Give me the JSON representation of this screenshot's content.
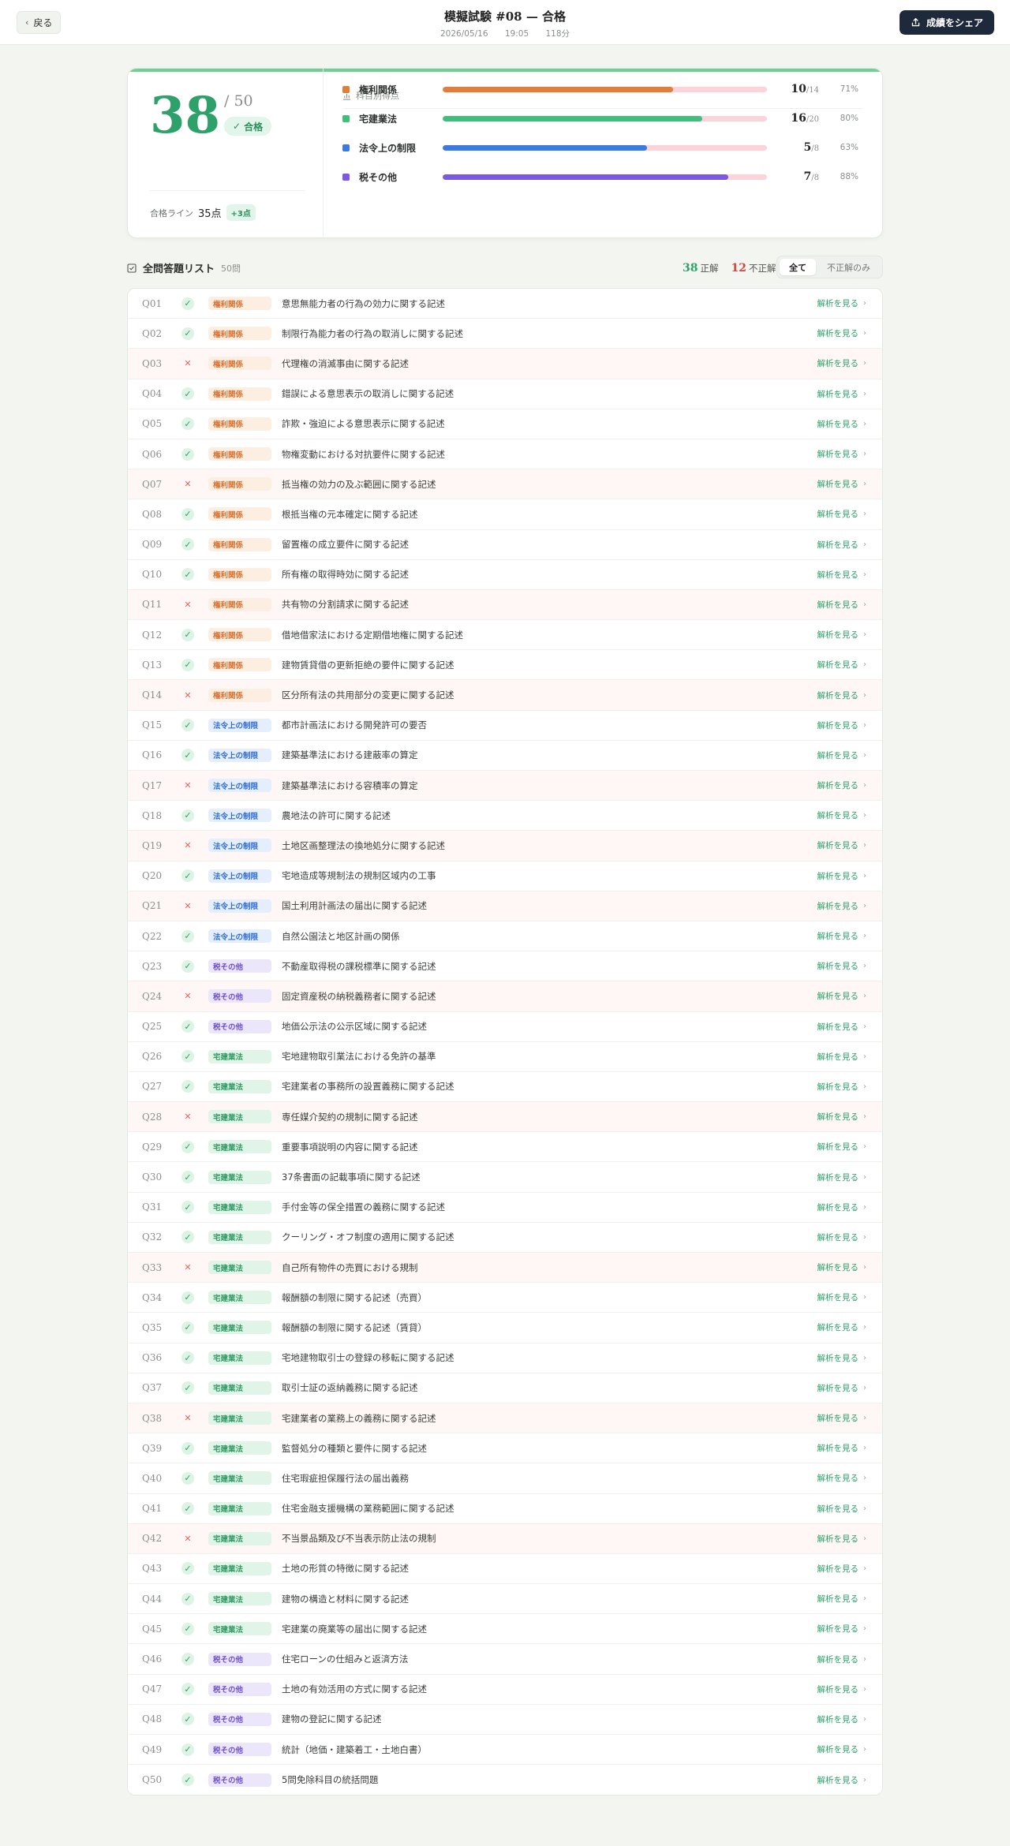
{
  "header": {
    "back_label": "戻る",
    "title": "模擬試験 #08 — 合格",
    "date": "2026/05/16",
    "time": "19:05",
    "duration": "118分",
    "share_label": "成績をシェア"
  },
  "score": {
    "value": "38",
    "total": "/ 50",
    "badge": "合格",
    "passline_label": "合格ライン",
    "passline_value": "35点",
    "passline_diff": "+3点"
  },
  "subjects": {
    "title": "科目別得点",
    "items": [
      {
        "name": "権利関係",
        "score": "10",
        "max": "/14",
        "pct": "71%",
        "ratio": 0.71,
        "color": "#e07f3a"
      },
      {
        "name": "宅建業法",
        "score": "16",
        "max": "/20",
        "pct": "80%",
        "ratio": 0.8,
        "color": "#3fbf7a"
      },
      {
        "name": "法令上の制限",
        "score": "5",
        "max": "/8",
        "pct": "63%",
        "ratio": 0.63,
        "color": "#3b7be0"
      },
      {
        "name": "税その他",
        "score": "7",
        "max": "/8",
        "pct": "88%",
        "ratio": 0.88,
        "color": "#7a5ae0"
      }
    ]
  },
  "list": {
    "title": "全問答題リスト",
    "count": "50問",
    "correct_count": "38",
    "correct_label": "正解",
    "wrong_count": "12",
    "wrong_label": "不正解",
    "filter_all": "全て",
    "filter_wrong": "不正解のみ",
    "link_label": "解析を見る"
  },
  "tag_styles": {
    "権利関係": {
      "bg": "#fdeee2",
      "fg": "#d87230"
    },
    "宅建業法": {
      "bg": "#e0f4e8",
      "fg": "#2e9a62"
    },
    "法令上の制限": {
      "bg": "#e4eefc",
      "fg": "#2f6ed0"
    },
    "税その他": {
      "bg": "#ece6fb",
      "fg": "#7050d0"
    }
  },
  "questions": [
    {
      "no": "Q01",
      "ok": true,
      "tag": "権利関係",
      "text": "意思無能力者の行為の効力に関する記述"
    },
    {
      "no": "Q02",
      "ok": true,
      "tag": "権利関係",
      "text": "制限行為能力者の行為の取消しに関する記述"
    },
    {
      "no": "Q03",
      "ok": false,
      "tag": "権利関係",
      "text": "代理権の消滅事由に関する記述"
    },
    {
      "no": "Q04",
      "ok": true,
      "tag": "権利関係",
      "text": "錯誤による意思表示の取消しに関する記述"
    },
    {
      "no": "Q05",
      "ok": true,
      "tag": "権利関係",
      "text": "詐欺・強迫による意思表示に関する記述"
    },
    {
      "no": "Q06",
      "ok": true,
      "tag": "権利関係",
      "text": "物権変動における対抗要件に関する記述"
    },
    {
      "no": "Q07",
      "ok": false,
      "tag": "権利関係",
      "text": "抵当権の効力の及ぶ範囲に関する記述"
    },
    {
      "no": "Q08",
      "ok": true,
      "tag": "権利関係",
      "text": "根抵当権の元本確定に関する記述"
    },
    {
      "no": "Q09",
      "ok": true,
      "tag": "権利関係",
      "text": "留置権の成立要件に関する記述"
    },
    {
      "no": "Q10",
      "ok": true,
      "tag": "権利関係",
      "text": "所有権の取得時効に関する記述"
    },
    {
      "no": "Q11",
      "ok": false,
      "tag": "権利関係",
      "text": "共有物の分割請求に関する記述"
    },
    {
      "no": "Q12",
      "ok": true,
      "tag": "権利関係",
      "text": "借地借家法における定期借地権に関する記述"
    },
    {
      "no": "Q13",
      "ok": true,
      "tag": "権利関係",
      "text": "建物賃貸借の更新拒絶の要件に関する記述"
    },
    {
      "no": "Q14",
      "ok": false,
      "tag": "権利関係",
      "text": "区分所有法の共用部分の変更に関する記述"
    },
    {
      "no": "Q15",
      "ok": true,
      "tag": "法令上の制限",
      "text": "都市計画法における開発許可の要否"
    },
    {
      "no": "Q16",
      "ok": true,
      "tag": "法令上の制限",
      "text": "建築基準法における建蔽率の算定"
    },
    {
      "no": "Q17",
      "ok": false,
      "tag": "法令上の制限",
      "text": "建築基準法における容積率の算定"
    },
    {
      "no": "Q18",
      "ok": true,
      "tag": "法令上の制限",
      "text": "農地法の許可に関する記述"
    },
    {
      "no": "Q19",
      "ok": false,
      "tag": "法令上の制限",
      "text": "土地区画整理法の換地処分に関する記述"
    },
    {
      "no": "Q20",
      "ok": true,
      "tag": "法令上の制限",
      "text": "宅地造成等規制法の規制区域内の工事"
    },
    {
      "no": "Q21",
      "ok": false,
      "tag": "法令上の制限",
      "text": "国土利用計画法の届出に関する記述"
    },
    {
      "no": "Q22",
      "ok": true,
      "tag": "法令上の制限",
      "text": "自然公園法と地区計画の関係"
    },
    {
      "no": "Q23",
      "ok": true,
      "tag": "税その他",
      "text": "不動産取得税の課税標準に関する記述"
    },
    {
      "no": "Q24",
      "ok": false,
      "tag": "税その他",
      "text": "固定資産税の納税義務者に関する記述"
    },
    {
      "no": "Q25",
      "ok": true,
      "tag": "税その他",
      "text": "地価公示法の公示区域に関する記述"
    },
    {
      "no": "Q26",
      "ok": true,
      "tag": "宅建業法",
      "text": "宅地建物取引業法における免許の基準"
    },
    {
      "no": "Q27",
      "ok": true,
      "tag": "宅建業法",
      "text": "宅建業者の事務所の設置義務に関する記述"
    },
    {
      "no": "Q28",
      "ok": false,
      "tag": "宅建業法",
      "text": "専任媒介契約の規制に関する記述"
    },
    {
      "no": "Q29",
      "ok": true,
      "tag": "宅建業法",
      "text": "重要事項説明の内容に関する記述"
    },
    {
      "no": "Q30",
      "ok": true,
      "tag": "宅建業法",
      "text": "37条書面の記載事項に関する記述"
    },
    {
      "no": "Q31",
      "ok": true,
      "tag": "宅建業法",
      "text": "手付金等の保全措置の義務に関する記述"
    },
    {
      "no": "Q32",
      "ok": true,
      "tag": "宅建業法",
      "text": "クーリング・オフ制度の適用に関する記述"
    },
    {
      "no": "Q33",
      "ok": false,
      "tag": "宅建業法",
      "text": "自己所有物件の売買における規制"
    },
    {
      "no": "Q34",
      "ok": true,
      "tag": "宅建業法",
      "text": "報酬額の制限に関する記述（売買）"
    },
    {
      "no": "Q35",
      "ok": true,
      "tag": "宅建業法",
      "text": "報酬額の制限に関する記述（賃貸）"
    },
    {
      "no": "Q36",
      "ok": true,
      "tag": "宅建業法",
      "text": "宅地建物取引士の登録の移転に関する記述"
    },
    {
      "no": "Q37",
      "ok": true,
      "tag": "宅建業法",
      "text": "取引士証の返納義務に関する記述"
    },
    {
      "no": "Q38",
      "ok": false,
      "tag": "宅建業法",
      "text": "宅建業者の業務上の義務に関する記述"
    },
    {
      "no": "Q39",
      "ok": true,
      "tag": "宅建業法",
      "text": "監督処分の種類と要件に関する記述"
    },
    {
      "no": "Q40",
      "ok": true,
      "tag": "宅建業法",
      "text": "住宅瑕疵担保履行法の届出義務"
    },
    {
      "no": "Q41",
      "ok": true,
      "tag": "宅建業法",
      "text": "住宅金融支援機構の業務範囲に関する記述"
    },
    {
      "no": "Q42",
      "ok": false,
      "tag": "宅建業法",
      "text": "不当景品類及び不当表示防止法の規制"
    },
    {
      "no": "Q43",
      "ok": true,
      "tag": "宅建業法",
      "text": "土地の形質の特徴に関する記述"
    },
    {
      "no": "Q44",
      "ok": true,
      "tag": "宅建業法",
      "text": "建物の構造と材料に関する記述"
    },
    {
      "no": "Q45",
      "ok": true,
      "tag": "宅建業法",
      "text": "宅建業の廃業等の届出に関する記述"
    },
    {
      "no": "Q46",
      "ok": true,
      "tag": "税その他",
      "text": "住宅ローンの仕組みと返済方法"
    },
    {
      "no": "Q47",
      "ok": true,
      "tag": "税その他",
      "text": "土地の有効活用の方式に関する記述"
    },
    {
      "no": "Q48",
      "ok": true,
      "tag": "税その他",
      "text": "建物の登記に関する記述"
    },
    {
      "no": "Q49",
      "ok": true,
      "tag": "税その他",
      "text": "統計（地価・建築着工・土地白書）"
    },
    {
      "no": "Q50",
      "ok": true,
      "tag": "税その他",
      "text": "5問免除科目の統括問題"
    }
  ]
}
